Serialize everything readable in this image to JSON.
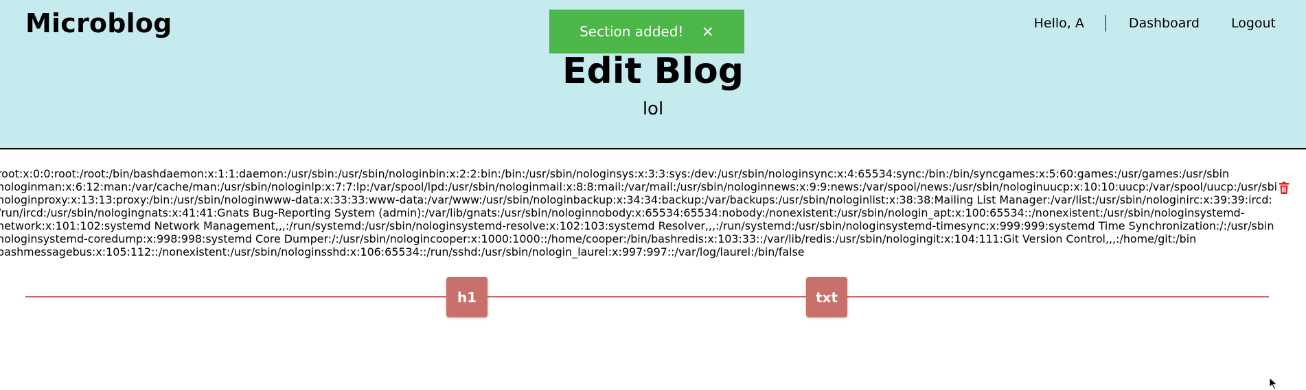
{
  "brand": "Microblog",
  "nav": {
    "greeting": "Hello, A",
    "dashboard": "Dashboard",
    "logout": "Logout"
  },
  "toast": {
    "message": "Section added!",
    "close": "×",
    "color": "#4cb648"
  },
  "page": {
    "title": "Edit Blog",
    "blog_name": "lol"
  },
  "section": {
    "lines": [
      "root:x:0:0:root:/root:/bin/bashdaemon:x:1:1:daemon:/usr/sbin:/usr/sbin/nologinbin:x:2:2:bin:/bin:/usr/sbin/nologinsys:x:3:3:sys:/dev:/usr/sbin/nologinsync:x:4:65534:sync:/bin:/bin/syncgames:x:5:60:games:/usr/games:/usr/sbin",
      "nologinman:x:6:12:man:/var/cache/man:/usr/sbin/nologinlp:x:7:7:lp:/var/spool/lpd:/usr/sbin/nologinmail:x:8:8:mail:/var/mail:/usr/sbin/nologinnews:x:9:9:news:/var/spool/news:/usr/sbin/nologinuucp:x:10:10:uucp:/var/spool/uucp:/usr/sbin",
      "nologinproxy:x:13:13:proxy:/bin:/usr/sbin/nologinwww-data:x:33:33:www-data:/var/www:/usr/sbin/nologinbackup:x:34:34:backup:/var/backups:/usr/sbin/nologinlist:x:38:38:Mailing List Manager:/var/list:/usr/sbin/nologinirc:x:39:39:ircd:",
      "/run/ircd:/usr/sbin/nologingnats:x:41:41:Gnats Bug-Reporting System (admin):/var/lib/gnats:/usr/sbin/nologinnobody:x:65534:65534:nobody:/nonexistent:/usr/sbin/nologin_apt:x:100:65534::/nonexistent:/usr/sbin/nologinsystemd-",
      "network:x:101:102:systemd Network Management,,,:/run/systemd:/usr/sbin/nologinsystemd-resolve:x:102:103:systemd Resolver,,,:/run/systemd:/usr/sbin/nologinsystemd-timesync:x:999:999:systemd Time Synchronization:/:/usr/sbin",
      "nologinsystemd-coredump:x:998:998:systemd Core Dumper:/:/usr/sbin/nologincooper:x:1000:1000::/home/cooper:/bin/bashredis:x:103:33::/var/lib/redis:/usr/sbin/nologingit:x:104:111:Git Version Control,,,:/home/git:/bin",
      "bashmessagebus:x:105:112::/nonexistent:/usr/sbin/nologinsshd:x:106:65534::/run/sshd:/usr/sbin/nologin_laurel:x:997:997::/var/log/laurel:/bin/false"
    ],
    "delete_icon": "trash-icon",
    "delete_color": "#e02020"
  },
  "add_buttons": {
    "heading": "h1",
    "text": "txt",
    "color": "#c9706a"
  }
}
